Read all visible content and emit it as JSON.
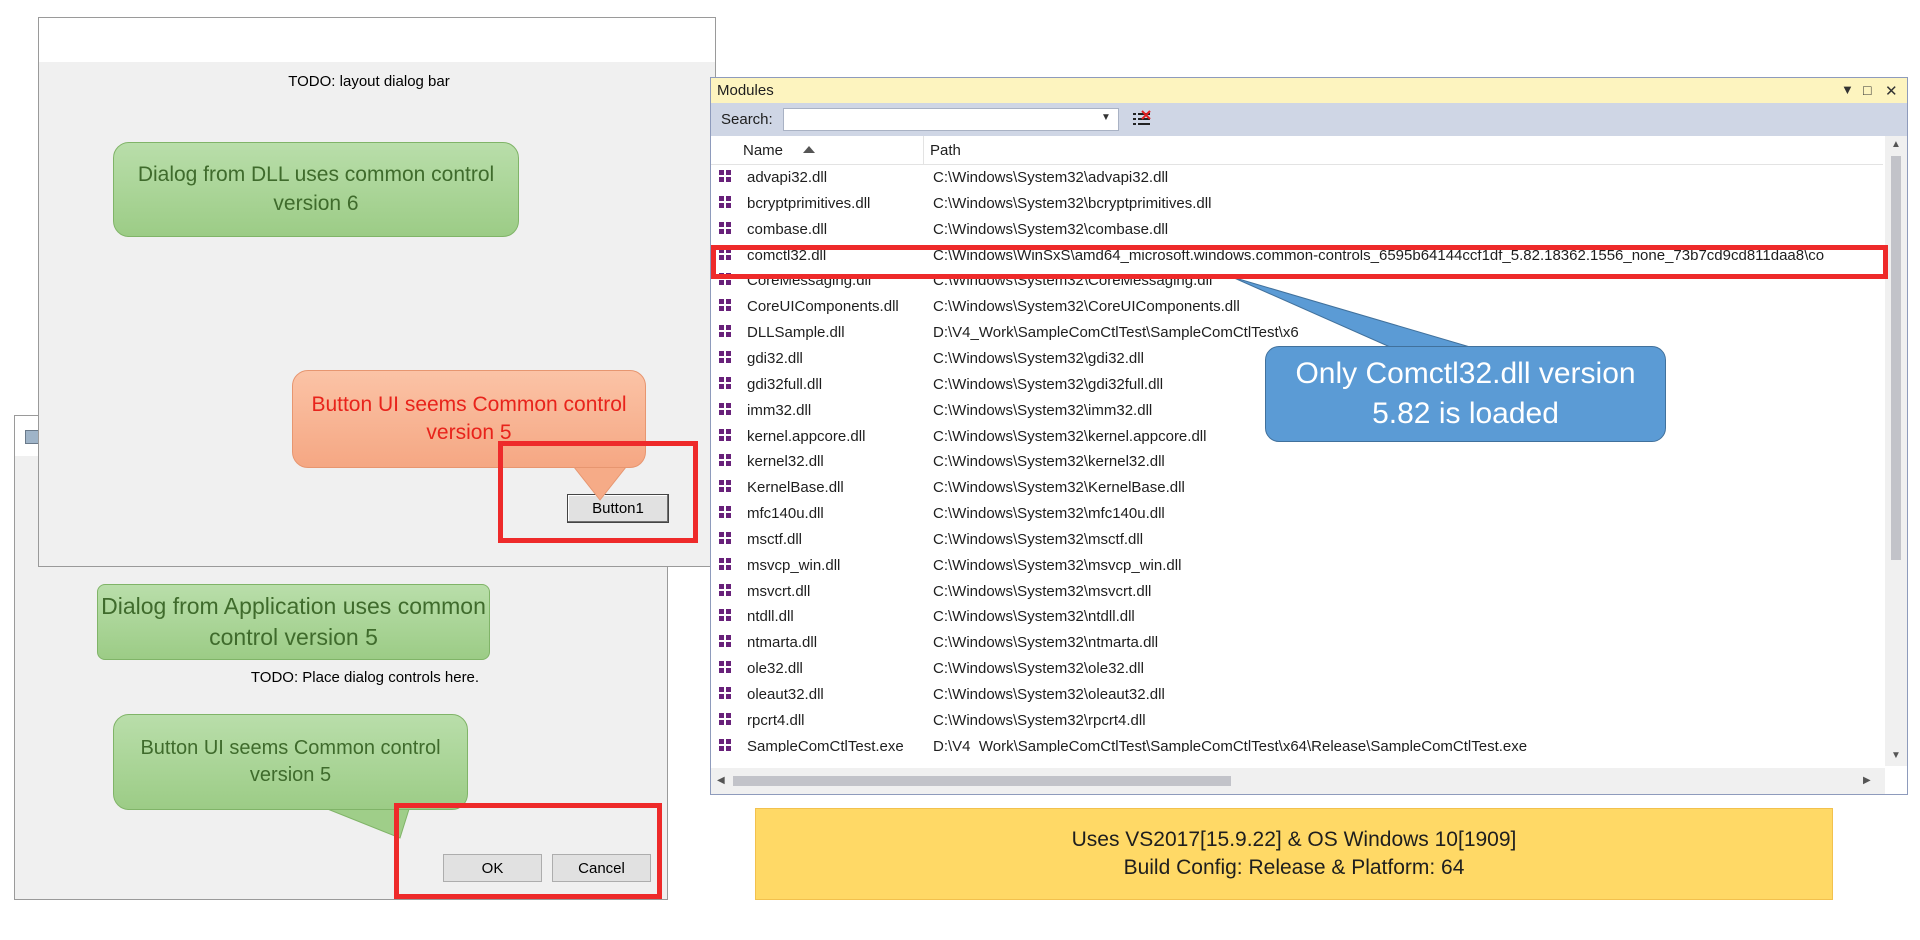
{
  "app_dialog": {
    "todo_text": "TODO: Place dialog controls here.",
    "ok_label": "OK",
    "cancel_label": "Cancel"
  },
  "dll_dialog": {
    "todo_text": "TODO: layout dialog bar",
    "button1_label": "Button1"
  },
  "callouts": {
    "dll_common": "Dialog from DLL uses common control version 6",
    "dll_button": "Button UI seems Common control version 5",
    "app_common": "Dialog from Application uses common control version 5",
    "app_button": "Button UI seems Common control version 5",
    "only_loaded": "Only Comctl32.dll version 5.82 is loaded"
  },
  "colors": {
    "green_callout": "#a9d597",
    "orange_callout": "#f8b593",
    "blue_callout": "#5b9bd5",
    "highlight_red": "#ee2a2a",
    "info_yellow": "#ffd966"
  },
  "modules": {
    "title": "Modules",
    "search_label": "Search:",
    "search_value": "",
    "columns": {
      "name": "Name",
      "path": "Path"
    },
    "sort": "ascending",
    "highlighted_row": "comctl32.dll",
    "rows": [
      {
        "name": "advapi32.dll",
        "path": "C:\\Windows\\System32\\advapi32.dll"
      },
      {
        "name": "bcryptprimitives.dll",
        "path": "C:\\Windows\\System32\\bcryptprimitives.dll"
      },
      {
        "name": "combase.dll",
        "path": "C:\\Windows\\System32\\combase.dll"
      },
      {
        "name": "comctl32.dll",
        "path": "C:\\Windows\\WinSxS\\amd64_microsoft.windows.common-controls_6595b64144ccf1df_5.82.18362.1556_none_73b7cd9cd811daa8\\co"
      },
      {
        "name": "CoreMessaging.dll",
        "path": "C:\\Windows\\System32\\CoreMessaging.dll"
      },
      {
        "name": "CoreUIComponents.dll",
        "path": "C:\\Windows\\System32\\CoreUIComponents.dll"
      },
      {
        "name": "DLLSample.dll",
        "path": "D:\\V4_Work\\SampleComCtlTest\\SampleComCtlTest\\x6"
      },
      {
        "name": "gdi32.dll",
        "path": "C:\\Windows\\System32\\gdi32.dll"
      },
      {
        "name": "gdi32full.dll",
        "path": "C:\\Windows\\System32\\gdi32full.dll"
      },
      {
        "name": "imm32.dll",
        "path": "C:\\Windows\\System32\\imm32.dll"
      },
      {
        "name": "kernel.appcore.dll",
        "path": "C:\\Windows\\System32\\kernel.appcore.dll"
      },
      {
        "name": "kernel32.dll",
        "path": "C:\\Windows\\System32\\kernel32.dll"
      },
      {
        "name": "KernelBase.dll",
        "path": "C:\\Windows\\System32\\KernelBase.dll"
      },
      {
        "name": "mfc140u.dll",
        "path": "C:\\Windows\\System32\\mfc140u.dll"
      },
      {
        "name": "msctf.dll",
        "path": "C:\\Windows\\System32\\msctf.dll"
      },
      {
        "name": "msvcp_win.dll",
        "path": "C:\\Windows\\System32\\msvcp_win.dll"
      },
      {
        "name": "msvcrt.dll",
        "path": "C:\\Windows\\System32\\msvcrt.dll"
      },
      {
        "name": "ntdll.dll",
        "path": "C:\\Windows\\System32\\ntdll.dll"
      },
      {
        "name": "ntmarta.dll",
        "path": "C:\\Windows\\System32\\ntmarta.dll"
      },
      {
        "name": "ole32.dll",
        "path": "C:\\Windows\\System32\\ole32.dll"
      },
      {
        "name": "oleaut32.dll",
        "path": "C:\\Windows\\System32\\oleaut32.dll"
      },
      {
        "name": "rpcrt4.dll",
        "path": "C:\\Windows\\System32\\rpcrt4.dll"
      },
      {
        "name": "SampleComCtlTest.exe",
        "path": "D:\\V4_Work\\SampleComCtlTest\\SampleComCtlTest\\x64\\Release\\SampleComCtlTest.exe"
      }
    ]
  },
  "info": {
    "line1": "Uses VS2017[15.9.22] & OS Windows 10[1909]",
    "line2": "Build Config: Release  & Platform: 64"
  }
}
